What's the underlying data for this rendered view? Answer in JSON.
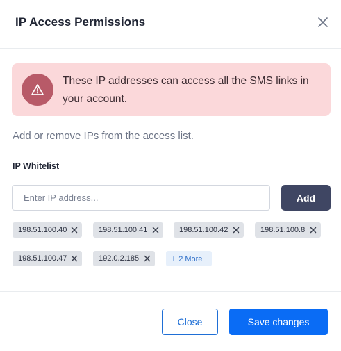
{
  "modal": {
    "title": "IP Access Permissions",
    "close_icon": "close-icon"
  },
  "alert": {
    "icon": "warning-icon",
    "text": "These IP addresses can access all the SMS links in your account.",
    "color_bg": "#fbd8da",
    "color_icon": "#b85a68"
  },
  "help_text": "Add or remove IPs from the access list.",
  "whitelist": {
    "label": "IP Whitelist",
    "input_placeholder": "Enter IP address...",
    "input_value": "",
    "add_label": "Add",
    "ips": [
      "198.51.100.40",
      "198.51.100.41",
      "198.51.100.42",
      "198.51.100.8",
      "198.51.100.47",
      "192.0.2.185"
    ],
    "more_label": "2 More"
  },
  "footer": {
    "close_label": "Close",
    "save_label": "Save changes"
  },
  "colors": {
    "primary": "#0a6cf5",
    "add_button": "#3f4663"
  }
}
